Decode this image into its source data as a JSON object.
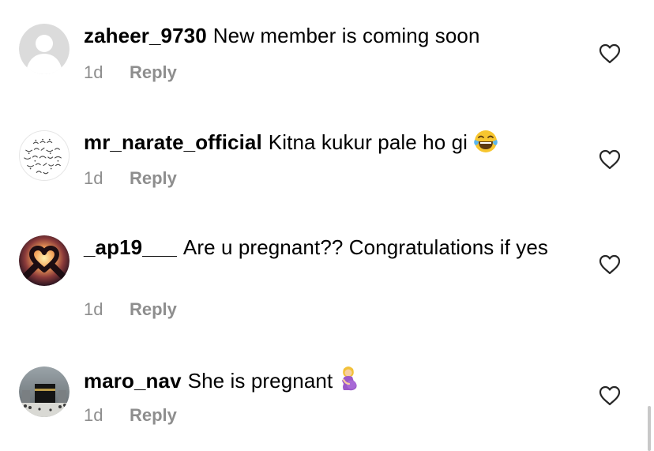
{
  "comments": [
    {
      "username": "zaheer_9730",
      "text": "New member is coming soon",
      "time": "1d",
      "reply_label": "Reply",
      "avatar": "default-avatar-icon"
    },
    {
      "username": "mr_narate_official",
      "text": "Kitna kukur pale ho gi",
      "emoji": "face-with-tears-of-joy-emoji",
      "time": "1d",
      "reply_label": "Reply",
      "avatar": "arabic-letters-avatar"
    },
    {
      "username": "_ap19___",
      "text": "Are u pregnant?? Congratulations if yes",
      "time": "1d",
      "reply_label": "Reply",
      "avatar": "heart-hands-sunset-avatar"
    },
    {
      "username": "maro_nav",
      "text": "She is pregnant",
      "emoji": "pregnant-woman-emoji",
      "time": "1d",
      "reply_label": "Reply",
      "avatar": "kaaba-photo-avatar"
    }
  ],
  "colors": {
    "meta_text": "#8e8e8e",
    "icon_stroke": "#262626",
    "avatar_default_bg": "#dbdbdb"
  }
}
